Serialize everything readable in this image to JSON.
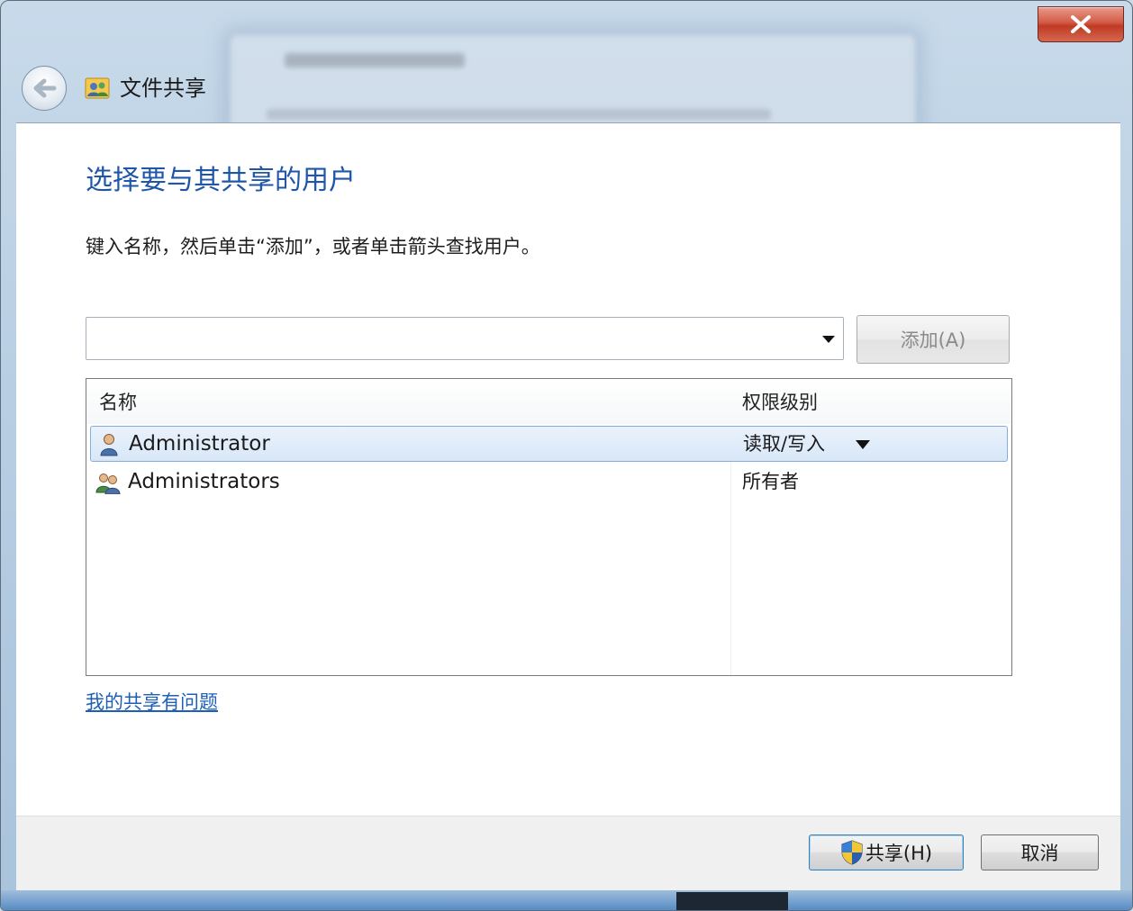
{
  "window": {
    "title": "文件共享",
    "close_icon": "close-icon",
    "back_icon": "back-arrow-icon"
  },
  "main": {
    "heading": "选择要与其共享的用户",
    "instruction": "键入名称，然后单击“添加”，或者单击箭头查找用户。",
    "name_input_value": "",
    "add_button_label": "添加(A)"
  },
  "table": {
    "columns": [
      "名称",
      "权限级别"
    ],
    "rows": [
      {
        "name": "Administrator",
        "permission": "读取/写入",
        "icon": "user-icon",
        "selected": true
      },
      {
        "name": "Administrators",
        "permission": "所有者",
        "icon": "user-group-icon",
        "selected": false
      }
    ]
  },
  "help_link": "我的共享有问题",
  "footer": {
    "share_button_label": "共享(H)",
    "cancel_button_label": "取消"
  },
  "colors": {
    "heading": "#1f56a8",
    "link": "#1f5fb8",
    "close_red": "#c03a24",
    "selection": "#d8e7f8"
  }
}
